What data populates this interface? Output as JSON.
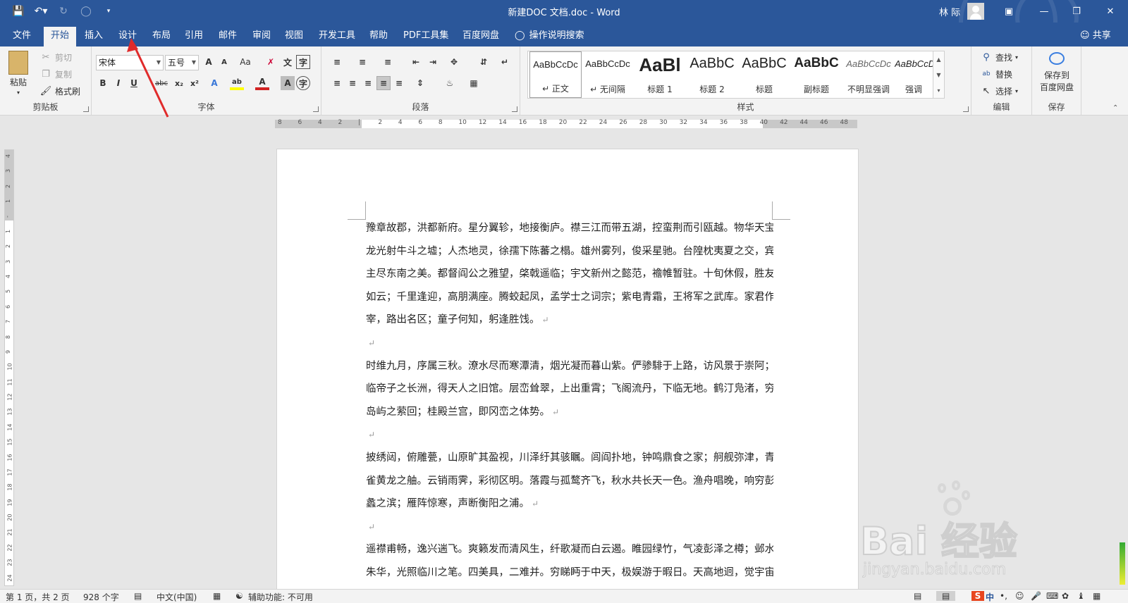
{
  "window": {
    "title": "新建DOC 文档.doc - Word",
    "user": "林 际",
    "share_label": "共享"
  },
  "tabs": [
    "文件",
    "开始",
    "插入",
    "设计",
    "布局",
    "引用",
    "邮件",
    "审阅",
    "视图",
    "开发工具",
    "帮助",
    "PDF工具集",
    "百度网盘"
  ],
  "active_tab": "开始",
  "tell_me": "操作说明搜索",
  "clipboard": {
    "paste": "粘贴",
    "cut": "剪切",
    "copy": "复制",
    "format_painter": "格式刷",
    "group_label": "剪贴板"
  },
  "font": {
    "name": "宋体",
    "size": "五号",
    "group_label": "字体",
    "grow": "A",
    "shrink": "A",
    "change_case": "Aa",
    "bold": "B",
    "italic": "I",
    "underline": "U",
    "strikethrough": "abc",
    "subscript": "x₂",
    "superscript": "x²",
    "text_effects": "A",
    "highlight": "ab",
    "font_color": "A",
    "char_shading": "A",
    "enclose": "字"
  },
  "paragraph": {
    "group_label": "段落"
  },
  "styles": {
    "group_label": "样式",
    "items": [
      {
        "sample": "AaBbCcDc",
        "name": "↵ 正文"
      },
      {
        "sample": "AaBbCcDc",
        "name": "↵ 无间隔"
      },
      {
        "sample": "AaBl",
        "name": "标题 1"
      },
      {
        "sample": "AaBbC",
        "name": "标题 2"
      },
      {
        "sample": "AaBbC",
        "name": "标题"
      },
      {
        "sample": "AaBbC",
        "name": "副标题"
      },
      {
        "sample": "AaBbCcDc",
        "name": "不明显强调"
      },
      {
        "sample": "AaBbCcDc",
        "name": "强调"
      }
    ]
  },
  "editing": {
    "find": "查找",
    "replace": "替换",
    "select": "选择",
    "group_label": "编辑"
  },
  "save_group": {
    "button_line1": "保存到",
    "button_line2": "百度网盘",
    "group_label": "保存"
  },
  "ruler": {
    "h_labels": [
      "8",
      "6",
      "4",
      "2",
      "",
      "2",
      "4",
      "6",
      "8",
      "10",
      "12",
      "14",
      "16",
      "18",
      "20",
      "22",
      "24",
      "26",
      "28",
      "30",
      "32",
      "34",
      "36",
      "38",
      "40",
      "42",
      "44",
      "46",
      "48"
    ],
    "v_labels": [
      "4",
      "3",
      "2",
      "1",
      "",
      "1",
      "2",
      "3",
      "4",
      "5",
      "6",
      "7",
      "8",
      "9",
      "10",
      "11",
      "12",
      "13",
      "14",
      "15",
      "16",
      "17",
      "18",
      "19",
      "20",
      "21",
      "22",
      "23",
      "24"
    ],
    "corner": "L"
  },
  "document": {
    "lines": [
      "豫章故郡，洪都新府。星分翼轸，地接衡庐。襟三江而带五湖，控蛮荆而引瓯越。物华天宝，",
      "龙光射牛斗之墟；人杰地灵，徐孺下陈蕃之榻。雄州雾列，俊采星驰。台隍枕夷夏之交，宾",
      "主尽东南之美。都督阎公之雅望，棨戟遥临；宇文新州之懿范，襜帷暂驻。十旬休假，胜友",
      "如云；千里逢迎，高朋满座。腾蛟起凤，孟学士之词宗；紫电青霜，王将军之武库。家君作",
      "宰，路出名区；童子何知，躬逢胜饯。",
      "",
      "时维九月，序属三秋。潦水尽而寒潭清，烟光凝而暮山紫。俨骖騑于上路，访风景于崇阿；",
      "临帝子之长洲，得天人之旧馆。层峦耸翠，上出重霄；飞阁流丹，下临无地。鹤汀凫渚，穷",
      "岛屿之萦回；桂殿兰宫，即冈峦之体势。",
      "",
      "披绣闼，俯雕甍，山原旷其盈视，川泽纡其骇瞩。闾阎扑地，钟鸣鼎食之家；舸舰弥津，青",
      "雀黄龙之舳。云销雨霁，彩彻区明。落霞与孤鹜齐飞，秋水共长天一色。渔舟唱晚，响穷彭",
      "蠡之滨；雁阵惊寒，声断衡阳之浦。",
      "",
      "遥襟甫畅，逸兴遄飞。爽籁发而清风生，纤歌凝而白云遏。睢园绿竹，气凌彭泽之樽；邺水",
      "朱华，光照临川之笔。四美具，二难并。穷睇眄于中天，极娱游于暇日。天高地迥，觉宇宙"
    ],
    "paragraph_ends": [
      4,
      5,
      8,
      9,
      12,
      13
    ]
  },
  "status": {
    "page": "第 1 页，共 2 页",
    "words": "928 个字",
    "language": "中文(中国)",
    "accessibility": "辅助功能: 不可用"
  },
  "ime": {
    "lang": "中"
  },
  "watermark": {
    "text": "Bai 经验",
    "url": "jingyan.baidu.com"
  },
  "colors": {
    "brand": "#2b579a",
    "highlight": "#ffff00",
    "font_color": "#d22222",
    "arrow": "#e02b2b"
  }
}
